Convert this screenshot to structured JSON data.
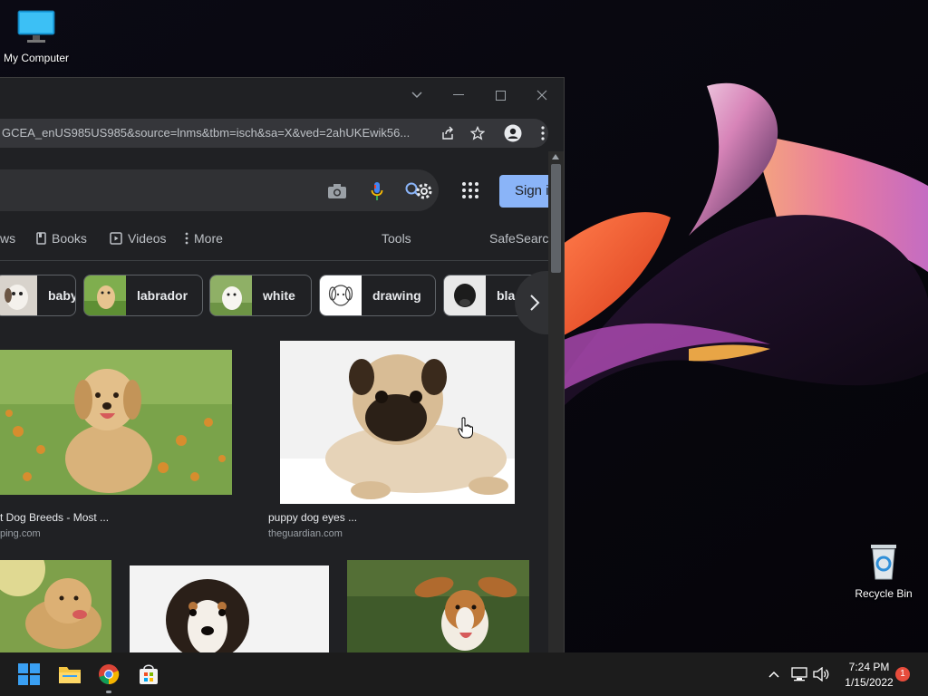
{
  "desktop": {
    "icons": [
      {
        "label": "My Computer",
        "icon": "monitor-icon"
      },
      {
        "label": "Recycle Bin",
        "icon": "recycle-bin-icon"
      }
    ]
  },
  "browser": {
    "window_controls": [
      "chevron-down-icon",
      "minimize-icon",
      "maximize-icon",
      "close-icon"
    ],
    "url": "GCEA_enUS985US985&source=lnms&tbm=isch&sa=X&ved=2ahUKEwik56...",
    "omnibar_icons": [
      "share-icon",
      "star-icon",
      "profile-icon",
      "kebab-menu-icon"
    ],
    "search": {
      "icons": [
        "camera-icon",
        "mic-icon",
        "search-settings-icon"
      ],
      "signin_label": "Sign in"
    },
    "tabs": [
      {
        "label": "ws",
        "icon": ""
      },
      {
        "label": "Books",
        "icon": "book-icon"
      },
      {
        "label": "Videos",
        "icon": "video-icon"
      },
      {
        "label": "More",
        "icon": "more-vert-icon"
      },
      {
        "label": "Tools",
        "icon": ""
      },
      {
        "label": "SafeSearch",
        "icon": ""
      }
    ],
    "chips": [
      {
        "label": "baby"
      },
      {
        "label": "labrador"
      },
      {
        "label": "white"
      },
      {
        "label": "drawing"
      },
      {
        "label": "bla"
      }
    ],
    "results": [
      {
        "caption": "t Dog Breeds - Most ...",
        "source": "ping.com"
      },
      {
        "caption": "puppy dog eyes ...",
        "source": "theguardian.com"
      }
    ]
  },
  "taskbar": {
    "apps": [
      "windows-start-icon",
      "file-explorer-icon",
      "chrome-icon",
      "store-icon"
    ],
    "time": "7:24 PM",
    "date": "1/15/2022",
    "notification_count": "1"
  },
  "colors": {
    "accent": "#8ab4f8",
    "page_bg": "#202124",
    "taskbar_bg": "#1c1c1c"
  }
}
